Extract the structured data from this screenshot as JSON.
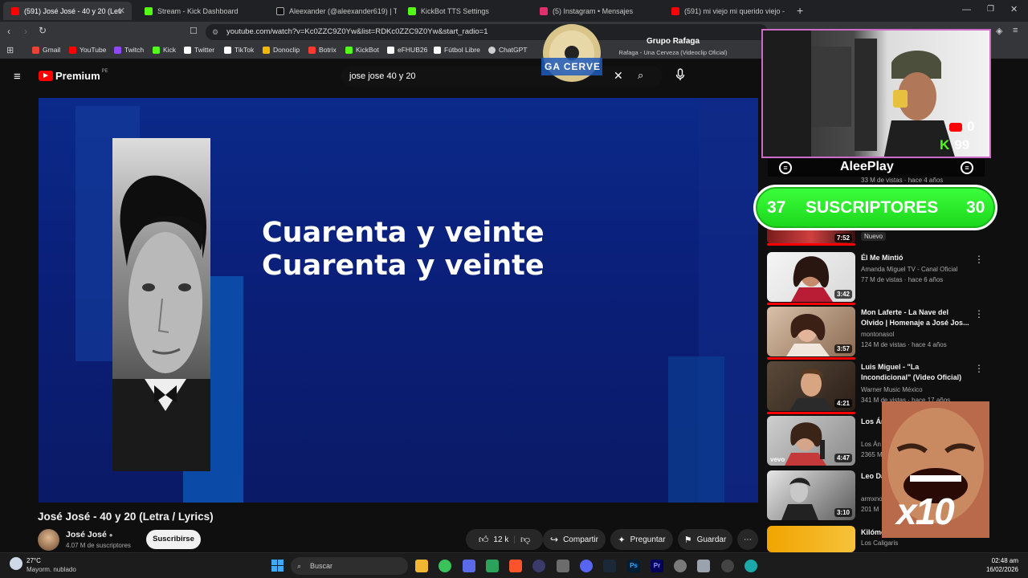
{
  "tabs": [
    {
      "label": "(591) José José - 40 y 20 (Letr",
      "color": "#ff0000"
    },
    {
      "label": "Stream - Kick Dashboard",
      "color": "#53fc18"
    },
    {
      "label": "Aleexander (@aleexander619) | TikTo",
      "color": "#ffffff"
    },
    {
      "label": "KickBot TTS Settings",
      "color": "#53fc18"
    },
    {
      "label": "(5) Instagram • Mensajes",
      "color": "#e1306c"
    },
    {
      "label": "(591) mi viejo mi querido viejo - You",
      "color": "#ff0000"
    }
  ],
  "address": {
    "url": "youtube.com/watch?v=Kc0ZZC9Z0Yw&list=RDKc0ZZC9Z0Yw&start_radio=1"
  },
  "bookmarks": [
    {
      "label": "Gmail",
      "color": "#ea4335"
    },
    {
      "label": "YouTube",
      "color": "#ff0000"
    },
    {
      "label": "Twitch",
      "color": "#9146ff"
    },
    {
      "label": "Kick",
      "color": "#53fc18"
    },
    {
      "label": "Twitter",
      "color": "#ffffff"
    },
    {
      "label": "TikTok",
      "color": "#ffffff"
    },
    {
      "label": "Donoclip",
      "color": "#f5b800"
    },
    {
      "label": "Botrix",
      "color": "#ff3b30"
    },
    {
      "label": "KickBot",
      "color": "#53fc18"
    },
    {
      "label": "eFHUB26",
      "color": "#ffffff"
    },
    {
      "label": "Fútbol Libre",
      "color": "#ffffff"
    },
    {
      "label": "ChatGPT",
      "color": "#cfcfcf"
    }
  ],
  "youtube": {
    "logo": "Premium",
    "logo_region": "PE",
    "search_value": "jose jose 40 y 20"
  },
  "video": {
    "lyric_line_1": "Cuarenta y veinte",
    "lyric_line_2": "Cuarenta y veinte",
    "title": "José José - 40 y 20 (Letra / Lyrics)",
    "channel": "José José",
    "subscribers": "4.07 M de suscriptores",
    "subscribe_label": "Suscribirse",
    "likes": "12 k",
    "share_label": "Compartir",
    "ask_label": "Preguntar",
    "save_label": "Guardar"
  },
  "now_playing": {
    "title": "Grupo Rafaga",
    "subtitle": "Rafaga - Una Cerveza (Videoclip Oficial)",
    "art_text": "GA CERVE"
  },
  "overlay": {
    "youtube_count": "0",
    "kick_count": "99",
    "username": "AleePlay",
    "sub_left": "37",
    "sub_label": "SUSCRIPTORES",
    "sub_right": "30",
    "multiplier": "x10",
    "partial_views": "33 M de vistas · hace 4 años"
  },
  "sidebar": [
    {
      "title": "",
      "channel": "Nuevo",
      "meta": "",
      "duration": "7:52"
    },
    {
      "title": "Él Me Mintió",
      "channel": "Amanda Miguel TV - Canal Oficial",
      "meta": "77 M de vistas · hace 6 años",
      "duration": "3:42"
    },
    {
      "title": "Mon Laferte - La Nave del Olvido | Homenaje a José Jos...",
      "channel": "montonasol",
      "meta": "124 M de vistas · hace 4 años",
      "duration": "3:57"
    },
    {
      "title": "Luis Miguel - \"La Incondicional\" (Video Oficial)",
      "channel": "Warner Music México",
      "meta": "341 M de vistas · hace 17 años",
      "duration": "4:21"
    },
    {
      "title": "Los Án Sufici",
      "channel": "Los Án",
      "meta": "2365 M",
      "duration": "4:47"
    },
    {
      "title": "Leo Da Amor",
      "channel": "armxno",
      "meta": "201 M",
      "duration": "3:10"
    },
    {
      "title": "Kilómetro",
      "channel": "Los Caligaris",
      "meta": "",
      "duration": ""
    }
  ],
  "taskbar": {
    "weather_temp": "27°C",
    "weather_desc": "Mayorm. nublado",
    "search_placeholder": "Buscar",
    "time": "02:48 am",
    "date": "16/02/2026"
  }
}
